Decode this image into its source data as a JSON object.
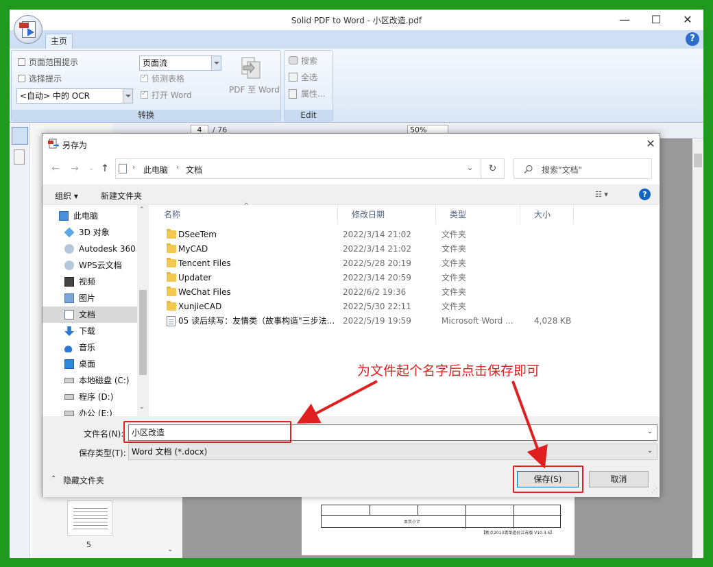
{
  "app": {
    "title": "Solid PDF to Word - 小区改造.pdf",
    "tab_home": "主页",
    "help": "?",
    "minimize": "—",
    "maximize": "☐",
    "close": "✕"
  },
  "ribbon": {
    "convert_group": {
      "label": "转换",
      "page_range_hint": "页面范围提示",
      "selection_hint": "选择提示",
      "ocr_select": "<自动> 中的 OCR",
      "layout_select": "页面流",
      "detect_tables": "侦测表格",
      "open_word": "打开 Word",
      "pdf_to_word": "PDF 至 Word"
    },
    "edit_group": {
      "label": "Edit",
      "search": "搜索",
      "select_all": "全选",
      "properties": "属性..."
    }
  },
  "toolbar2": {
    "page_input": "4",
    "page_total": "/ 76",
    "zoom": "50%"
  },
  "thumbnail": {
    "page_number": "5"
  },
  "preview": {
    "row_label": "本页小计",
    "footer": "【新点2013清单造价江苏版 V10.3.5】"
  },
  "dialog": {
    "title": "另存为",
    "close": "✕",
    "address": {
      "root": "此电脑",
      "current": "文档"
    },
    "search_placeholder": "搜索\"文档\"",
    "organize": "组织 ▾",
    "new_folder": "新建文件夹",
    "help": "?",
    "nav_items": [
      {
        "label": "此电脑",
        "icon": "computer-icon"
      },
      {
        "label": "3D 对象",
        "icon": "cube-icon"
      },
      {
        "label": "Autodesk 360",
        "icon": "cloud-icon"
      },
      {
        "label": "WPS云文档",
        "icon": "cloud-icon"
      },
      {
        "label": "视频",
        "icon": "film-icon"
      },
      {
        "label": "图片",
        "icon": "picture-icon"
      },
      {
        "label": "文档",
        "icon": "document-icon",
        "selected": true
      },
      {
        "label": "下载",
        "icon": "download-icon"
      },
      {
        "label": "音乐",
        "icon": "music-icon"
      },
      {
        "label": "桌面",
        "icon": "desktop-icon"
      },
      {
        "label": "本地磁盘 (C:)",
        "icon": "drive-icon"
      },
      {
        "label": "程序 (D:)",
        "icon": "drive-icon"
      },
      {
        "label": "办公 (E:)",
        "icon": "drive-icon"
      }
    ],
    "columns": {
      "name": "名称",
      "modified": "修改日期",
      "type": "类型",
      "size": "大小"
    },
    "files": [
      {
        "name": "DSeeTem",
        "modified": "2022/3/14 21:02",
        "type": "文件夹",
        "size": "",
        "kind": "folder"
      },
      {
        "name": "MyCAD",
        "modified": "2022/3/14 21:02",
        "type": "文件夹",
        "size": "",
        "kind": "folder"
      },
      {
        "name": "Tencent Files",
        "modified": "2022/5/28 20:19",
        "type": "文件夹",
        "size": "",
        "kind": "folder"
      },
      {
        "name": "Updater",
        "modified": "2022/3/14 20:59",
        "type": "文件夹",
        "size": "",
        "kind": "folder"
      },
      {
        "name": "WeChat Files",
        "modified": "2022/6/2 19:36",
        "type": "文件夹",
        "size": "",
        "kind": "folder"
      },
      {
        "name": "XunjieCAD",
        "modified": "2022/5/30 22:11",
        "type": "文件夹",
        "size": "",
        "kind": "folder"
      },
      {
        "name": "05 读后续写：友情类（故事构造\"三步法...",
        "modified": "2022/5/19 19:59",
        "type": "Microsoft Word ...",
        "size": "4,028 KB",
        "kind": "word"
      }
    ],
    "filename_label": "文件名(N):",
    "filename_value": "小区改造",
    "filetype_label": "保存类型(T):",
    "filetype_value": "Word 文档 (*.docx)",
    "hide_folders": "隐藏文件夹",
    "save": "保存(S)",
    "cancel": "取消"
  },
  "annotation": {
    "text": "为文件起个名字后点击保存即可",
    "color": "#e02020"
  }
}
